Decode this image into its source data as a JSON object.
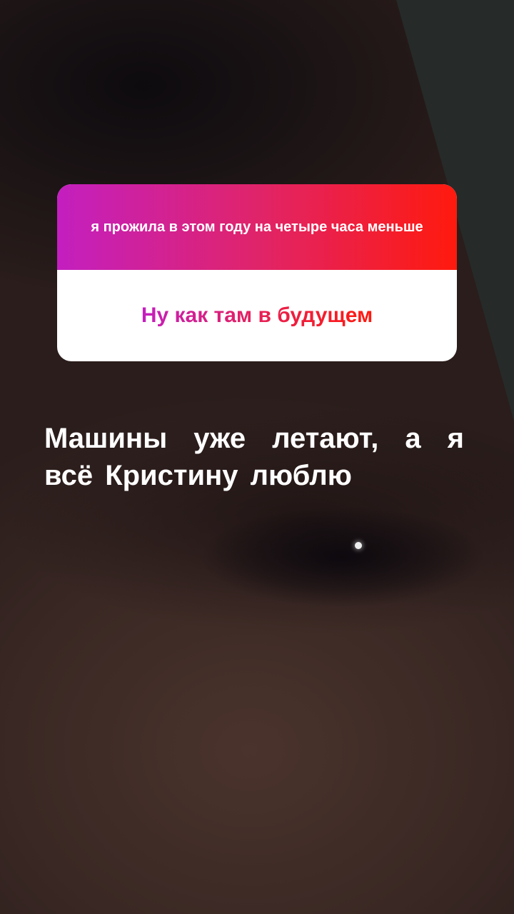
{
  "question_sticker": {
    "prompt": "я прожила в этом году на четыре часа меньше",
    "answer": "Ну как там в будущем"
  },
  "caption": {
    "text": "Машины уже летают, а я всё Кристину люблю"
  },
  "colors": {
    "gradient_start": "#c31fc0",
    "gradient_end": "#ff1a0d",
    "caption": "#ffffff"
  }
}
